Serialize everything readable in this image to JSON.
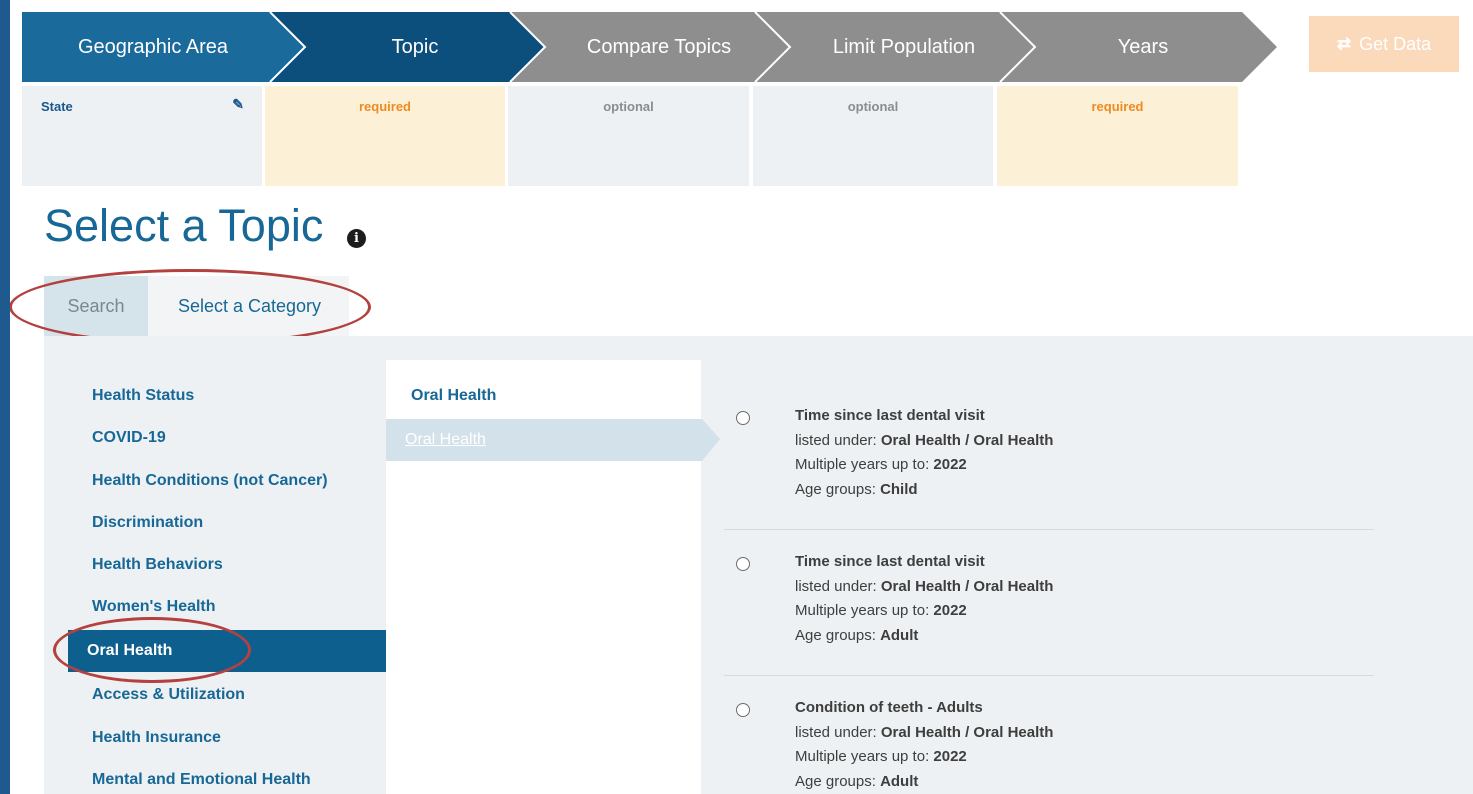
{
  "steps": [
    {
      "label": "Geographic Area",
      "status": "State"
    },
    {
      "label": "Topic",
      "status": "required"
    },
    {
      "label": "Compare Topics",
      "status": "optional"
    },
    {
      "label": "Limit Population",
      "status": "optional"
    },
    {
      "label": "Years",
      "status": "required"
    }
  ],
  "get_data": {
    "label": "Get Data",
    "icon": "retweet-icon"
  },
  "colors": {
    "step_geographic": "#1a6a9c",
    "step_topic_active": "#0d4f7c",
    "step_inactive": "#8e8e8e",
    "required_orange": "#ef8a22",
    "accent_blue": "#176896",
    "annotation_red": "#b3413f",
    "get_data_disabled": "#fbd9bb"
  },
  "title": "Select a Topic",
  "tabs": {
    "search": "Search",
    "category": "Select a Category",
    "active": "Select a Category"
  },
  "categories": [
    "Health Status",
    "COVID-19",
    "Health Conditions (not Cancer)",
    "Discrimination",
    "Health Behaviors",
    "Women's Health",
    "Oral Health",
    "Access & Utilization",
    "Health Insurance",
    "Mental and Emotional Health"
  ],
  "selected_category": "Oral Health",
  "subcategory": {
    "heading": "Oral Health",
    "items": [
      "Oral Health"
    ],
    "selected": "Oral Health"
  },
  "topics": [
    {
      "title": "Time since last dental visit",
      "listed_label": "listed under:",
      "listed_value": "Oral Health / Oral Health",
      "years_label": "Multiple years up to:",
      "years_value": "2022",
      "age_label": "Age groups:",
      "age_value": "Child"
    },
    {
      "title": "Time since last dental visit",
      "listed_label": "listed under:",
      "listed_value": "Oral Health / Oral Health",
      "years_label": "Multiple years up to:",
      "years_value": "2022",
      "age_label": "Age groups:",
      "age_value": "Adult"
    },
    {
      "title": "Condition of teeth - Adults",
      "listed_label": "listed under:",
      "listed_value": "Oral Health / Oral Health",
      "years_label": "Multiple years up to:",
      "years_value": "2022",
      "age_label": "Age groups:",
      "age_value": "Adult"
    }
  ]
}
